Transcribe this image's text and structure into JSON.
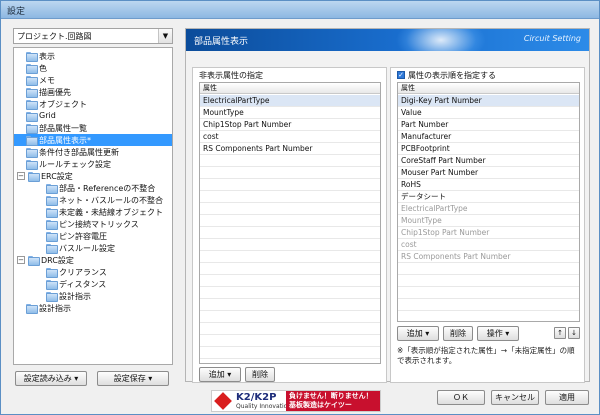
{
  "window": {
    "title": "設定"
  },
  "project_select": {
    "value": "プロジェクト.回路図"
  },
  "tree": [
    {
      "label": "表示",
      "depth": 0
    },
    {
      "label": "色",
      "depth": 0
    },
    {
      "label": "メモ",
      "depth": 0
    },
    {
      "label": "描画優先",
      "depth": 0
    },
    {
      "label": "オブジェクト",
      "depth": 0
    },
    {
      "label": "Grid",
      "depth": 0
    },
    {
      "label": "部品属性一覧",
      "depth": 0
    },
    {
      "label": "部品属性表示*",
      "depth": 0,
      "selected": true
    },
    {
      "label": "条件付き部品属性更新",
      "depth": 0
    },
    {
      "label": "ルールチェック設定",
      "depth": 0
    },
    {
      "label": "ERC設定",
      "depth": 0,
      "expander": "−"
    },
    {
      "label": "部品・Referenceの不整合",
      "depth": 1
    },
    {
      "label": "ネット・バスルールの不整合",
      "depth": 1
    },
    {
      "label": "未定義・未結線オブジェクト",
      "depth": 1
    },
    {
      "label": "ピン接続マトリックス",
      "depth": 1
    },
    {
      "label": "ピン許容電圧",
      "depth": 1
    },
    {
      "label": "バスルール設定",
      "depth": 1
    },
    {
      "label": "DRC設定",
      "depth": 0,
      "expander": "−"
    },
    {
      "label": "クリアランス",
      "depth": 1
    },
    {
      "label": "ディスタンス",
      "depth": 1
    },
    {
      "label": "設計指示",
      "depth": 1
    },
    {
      "label": "設計指示",
      "depth": 0
    }
  ],
  "left_buttons": {
    "load": "設定読み込み",
    "save": "設定保存"
  },
  "panel": {
    "title": "部品属性表示",
    "subtitle": "Circuit Setting"
  },
  "hidden_list": {
    "header": "非表示属性の指定",
    "column": "属性",
    "items": [
      "ElectricalPartType",
      "MountType",
      "Chip1Stop Part Number",
      "cost",
      "RS Components Part Number"
    ],
    "selected_index": 0,
    "add_label": "追加",
    "delete_label": "削除"
  },
  "order_list": {
    "checkbox_label": "属性の表示順を指定する",
    "checked": true,
    "column": "属性",
    "items": [
      "Digi-Key Part Number",
      "Value",
      "Part Number",
      "Manufacturer",
      "PCBFootprint",
      "CoreStaff Part Number",
      "Mouser Part Number",
      "RoHS",
      "データシート"
    ],
    "dim_items": [
      "ElectricalPartType",
      "MountType",
      "Chip1Stop Part Number",
      "cost",
      "RS Components Part Number"
    ],
    "add_label": "追加",
    "delete_label": "削除",
    "operation_label": "操作",
    "note": "※「表示順が指定された属性」→「未指定属性」の順で表示されます。"
  },
  "footer": {
    "ok": "ＯＫ",
    "cancel": "キャンセル",
    "apply": "適用"
  },
  "logo": {
    "brand": "K2/K2P",
    "tagline": "Quality Innovation",
    "slogan": "負けません！断りません！基板製造はケイツー"
  }
}
